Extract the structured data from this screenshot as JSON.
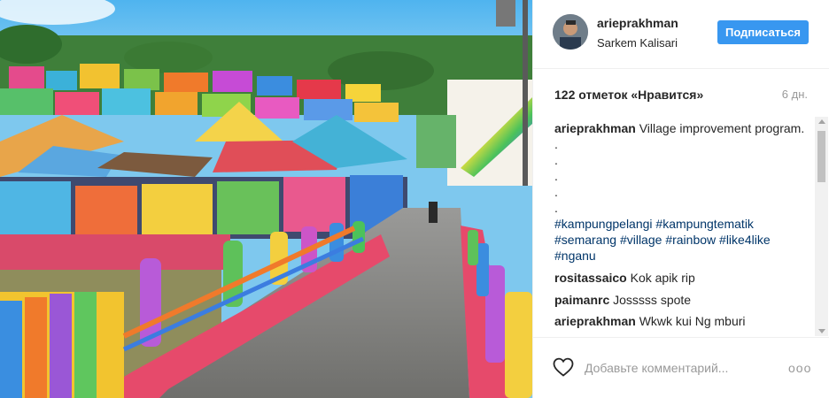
{
  "post": {
    "photo_name": "rainbow-village-photo"
  },
  "header": {
    "username": "arieprakhman",
    "location": "Sarkem Kalisari",
    "follow_label": "Подписаться"
  },
  "stats": {
    "likes": "122 отметок «Нравится»",
    "time": "6 дн."
  },
  "caption": {
    "user": "arieprakhman",
    "text": "Village improvement program.",
    "dots": [
      ".",
      ".",
      ".",
      ".",
      "."
    ],
    "hashtags": [
      "#kampungpelangi",
      "#kampungtematik",
      "#semarang",
      "#village",
      "#rainbow",
      "#like4like",
      "#nganu"
    ]
  },
  "comments": [
    {
      "user": "rositassaico",
      "text": "Kok apik rip"
    },
    {
      "user": "paimanrc",
      "text": "Josssss spote"
    },
    {
      "user": "arieprakhman",
      "text": "Wkwk kui Ng mburi"
    }
  ],
  "footer": {
    "comment_placeholder": "Добавьте комментарий...",
    "more": "ooo"
  },
  "colors": {
    "accent": "#3897f0",
    "hashtag": "#003569",
    "muted": "#999999"
  }
}
